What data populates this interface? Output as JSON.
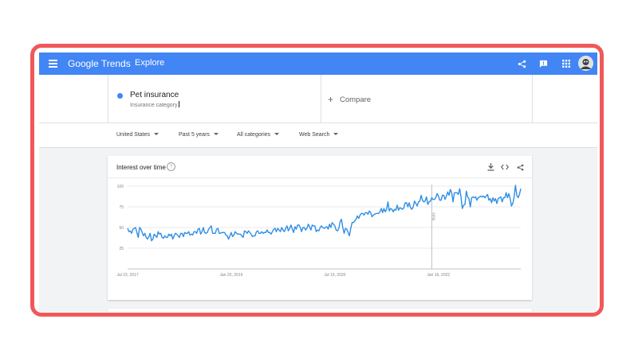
{
  "app": {
    "brand": "Google Trends",
    "nav": "Explore",
    "colors": {
      "header": "#4285f4",
      "series": "#2f8ee6",
      "highlight_frame": "#f0585a"
    },
    "icons": [
      "menu-icon",
      "share-icon",
      "feedback-icon",
      "apps-icon",
      "avatar"
    ]
  },
  "search": {
    "term": "Pet insurance",
    "term_category": "Insurance category",
    "compare_label": "Compare"
  },
  "filters": {
    "region": "United States",
    "time": "Past 5 years",
    "category": "All categories",
    "property": "Web Search"
  },
  "card": {
    "title": "Interest over time",
    "help": "?",
    "icons": [
      "download-icon",
      "embed-icon",
      "share-icon"
    ]
  },
  "chart_data": {
    "type": "line",
    "title": "Interest over time",
    "xlabel": "",
    "ylabel": "",
    "ylim": [
      0,
      100
    ],
    "y_ticks": [
      25,
      50,
      75,
      100
    ],
    "x_tick_labels": [
      "Jul 23, 2017",
      "Jan 20, 2019",
      "Jul 19, 2020",
      "Jan 16, 2022"
    ],
    "grid": true,
    "annotations": [
      {
        "text": "Note",
        "x_index": 229
      }
    ],
    "series": [
      {
        "values": [
          49,
          45,
          46,
          43,
          48,
          49,
          50,
          44,
          38,
          50,
          48,
          44,
          40,
          43,
          38,
          36,
          39,
          43,
          34,
          36,
          42,
          40,
          38,
          45,
          42,
          43,
          38,
          37,
          40,
          38,
          38,
          42,
          40,
          42,
          36,
          40,
          43,
          42,
          40,
          38,
          43,
          43,
          39,
          44,
          43,
          43,
          45,
          41,
          42,
          41,
          45,
          45,
          43,
          48,
          49,
          42,
          45,
          50,
          44,
          43,
          44,
          48,
          50,
          52,
          43,
          43,
          43,
          48,
          49,
          43,
          43,
          44,
          44,
          44,
          41,
          40,
          36,
          40,
          44,
          39,
          41,
          45,
          43,
          42,
          42,
          42,
          40,
          38,
          46,
          45,
          43,
          46,
          44,
          42,
          39,
          40,
          40,
          45,
          46,
          43,
          43,
          45,
          43,
          44,
          44,
          47,
          44,
          44,
          42,
          45,
          48,
          49,
          45,
          49,
          47,
          45,
          50,
          47,
          45,
          49,
          52,
          46,
          49,
          53,
          48,
          44,
          51,
          48,
          53,
          53,
          50,
          45,
          50,
          50,
          47,
          49,
          54,
          51,
          47,
          53,
          52,
          52,
          45,
          47,
          46,
          50,
          52,
          50,
          49,
          50,
          51,
          48,
          54,
          50,
          56,
          54,
          52,
          47,
          46,
          49,
          57,
          60,
          50,
          43,
          49,
          48,
          44,
          40,
          49,
          56,
          56,
          58,
          60,
          64,
          61,
          65,
          67,
          67,
          65,
          68,
          68,
          66,
          70,
          68,
          63,
          65,
          66,
          67,
          67,
          67,
          69,
          73,
          68,
          73,
          69,
          72,
          81,
          70,
          73,
          72,
          69,
          72,
          71,
          77,
          71,
          74,
          73,
          72,
          74,
          80,
          80,
          75,
          80,
          74,
          72,
          75,
          82,
          79,
          76,
          81,
          82,
          89,
          83,
          81,
          82,
          87,
          78,
          81,
          82,
          86,
          84,
          84,
          86,
          91,
          88,
          83,
          83,
          89,
          89,
          84,
          88,
          93,
          89,
          96,
          92,
          81,
          92,
          92,
          92,
          90,
          97,
          87,
          73,
          77,
          78,
          94,
          87,
          85,
          75,
          86,
          87,
          86,
          87,
          83,
          86,
          87,
          88,
          87,
          88,
          86,
          88,
          90,
          83,
          85,
          80,
          86,
          82,
          85,
          79,
          85,
          86,
          87,
          81,
          86,
          86,
          92,
          86,
          91,
          85,
          76,
          79,
          87,
          101,
          89,
          86,
          90,
          97
        ]
      }
    ]
  }
}
